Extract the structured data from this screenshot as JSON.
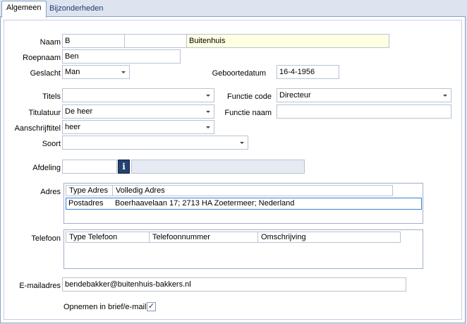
{
  "tabs": [
    {
      "label": "Algemeen"
    },
    {
      "label": "Bijzonderheden"
    }
  ],
  "form": {
    "naam_label": "Naam",
    "naam_first": "B",
    "naam_middle": "",
    "naam_last": "Buitenhuis",
    "roepnaam_label": "Roepnaam",
    "roepnaam": "Ben",
    "geslacht_label": "Geslacht",
    "geslacht": "Man",
    "geboortedatum_label": "Geboortedatum",
    "geboortedatum": "16-4-1956",
    "titels_label": "Titels",
    "titels": "",
    "functiecode_label": "Functie code",
    "functiecode": "Directeur",
    "titulatuur_label": "Titulatuur",
    "titulatuur": "De heer",
    "functienaam_label": "Functie naam",
    "functienaam": "",
    "aanschrijftitel_label": "Aanschrijftitel",
    "aanschrijftitel": "heer",
    "soort_label": "Soort",
    "soort": "",
    "afdeling_label": "Afdeling",
    "afdeling": "",
    "afdeling_info_glyph": "i",
    "afdeling_desc": "",
    "adres_label": "Adres",
    "telefoon_label": "Telefoon",
    "email_label": "E-mailadres",
    "email": "bendebakker@buitenhuis-bakkers.nl",
    "opnemen_label": "Opnemen in brief/e-mail",
    "opnemen_checked": true,
    "opnemen_glyph": "✓"
  },
  "adres_grid": {
    "columns": [
      "Type Adres",
      "Volledig Adres"
    ],
    "rows": [
      {
        "type": "Postadres",
        "adres": "Boerhaavelaan 17; 2713 HA  Zoetermeer; Nederland"
      }
    ]
  },
  "telefoon_grid": {
    "columns": [
      "Type Telefoon",
      "Telefoonnummer",
      "Omschrijving"
    ],
    "rows": []
  },
  "colors": {
    "background": "#dde4ef",
    "highlight_field": "#ffffe1",
    "info_button": "#24416f",
    "selection_border": "#3b7bd6"
  }
}
